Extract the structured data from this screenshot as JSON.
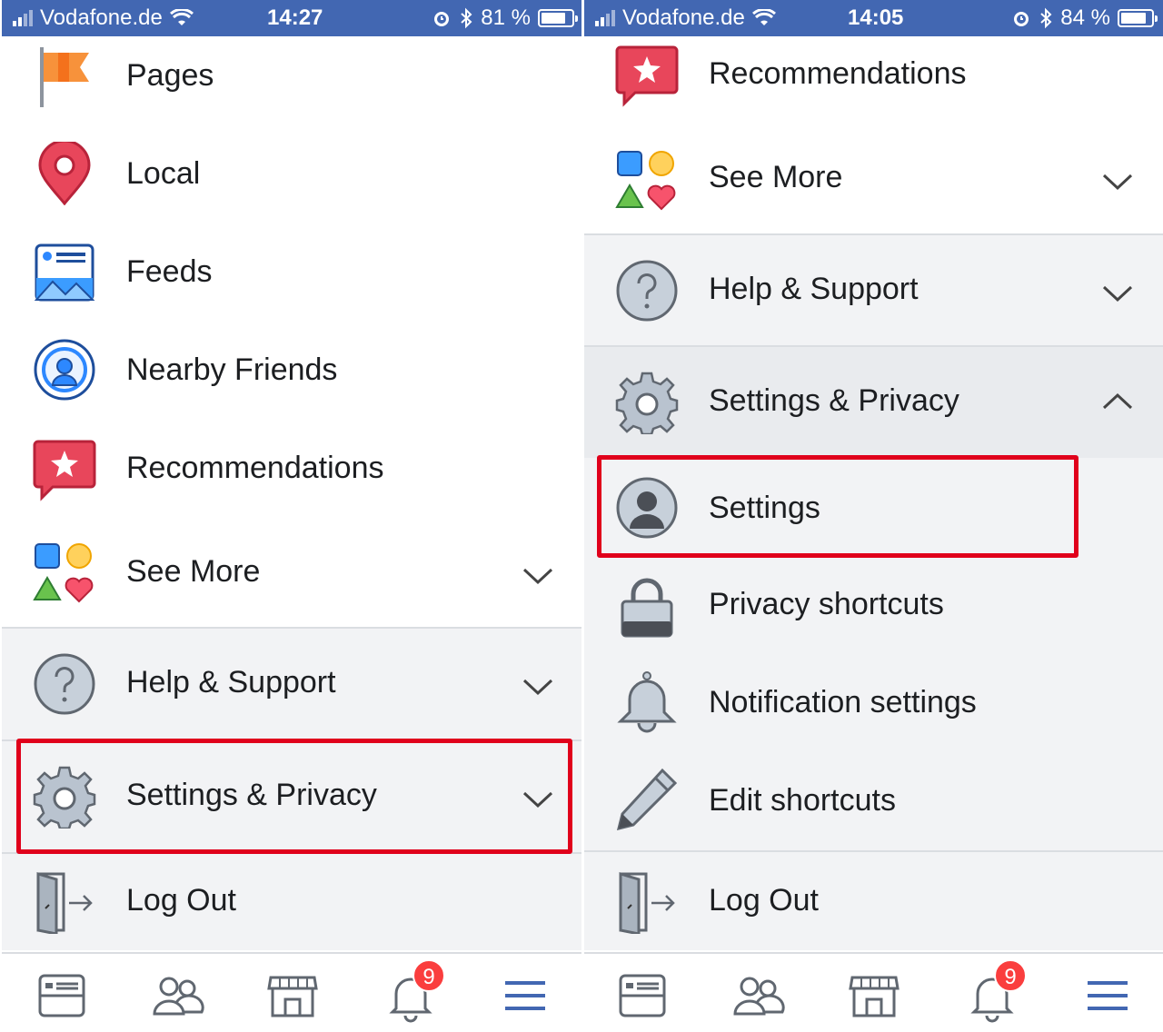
{
  "left": {
    "status": {
      "carrier": "Vodafone.de",
      "time": "14:27",
      "battery": "81 %",
      "battery_level": 0.81
    },
    "items": [
      {
        "label": "Pages",
        "icon": "flag-icon"
      },
      {
        "label": "Local",
        "icon": "location-pin-icon"
      },
      {
        "label": "Feeds",
        "icon": "feeds-icon"
      },
      {
        "label": "Nearby Friends",
        "icon": "nearby-friends-icon"
      },
      {
        "label": "Recommendations",
        "icon": "recommendations-icon"
      },
      {
        "label": "See More",
        "icon": "shapes-icon"
      },
      {
        "label": "Help & Support",
        "icon": "help-icon"
      },
      {
        "label": "Settings & Privacy",
        "icon": "gear-icon"
      },
      {
        "label": "Log Out",
        "icon": "log-out-icon"
      }
    ],
    "badge": "9"
  },
  "right": {
    "status": {
      "carrier": "Vodafone.de",
      "time": "14:05",
      "battery": "84 %",
      "battery_level": 0.84
    },
    "items": [
      {
        "label": "Recommendations",
        "icon": "recommendations-icon"
      },
      {
        "label": "See More",
        "icon": "shapes-icon"
      },
      {
        "label": "Help & Support",
        "icon": "help-icon"
      },
      {
        "label": "Settings & Privacy",
        "icon": "gear-icon"
      },
      {
        "label": "Settings",
        "icon": "profile-icon"
      },
      {
        "label": "Privacy shortcuts",
        "icon": "lock-icon"
      },
      {
        "label": "Notification settings",
        "icon": "bell-icon"
      },
      {
        "label": "Edit shortcuts",
        "icon": "pencil-icon"
      },
      {
        "label": "Log Out",
        "icon": "log-out-icon"
      }
    ],
    "badge": "9"
  },
  "colors": {
    "brand": "#4267b2",
    "highlight": "#e0001b",
    "badge": "#fa3e3e",
    "text": "#1c1e21"
  }
}
